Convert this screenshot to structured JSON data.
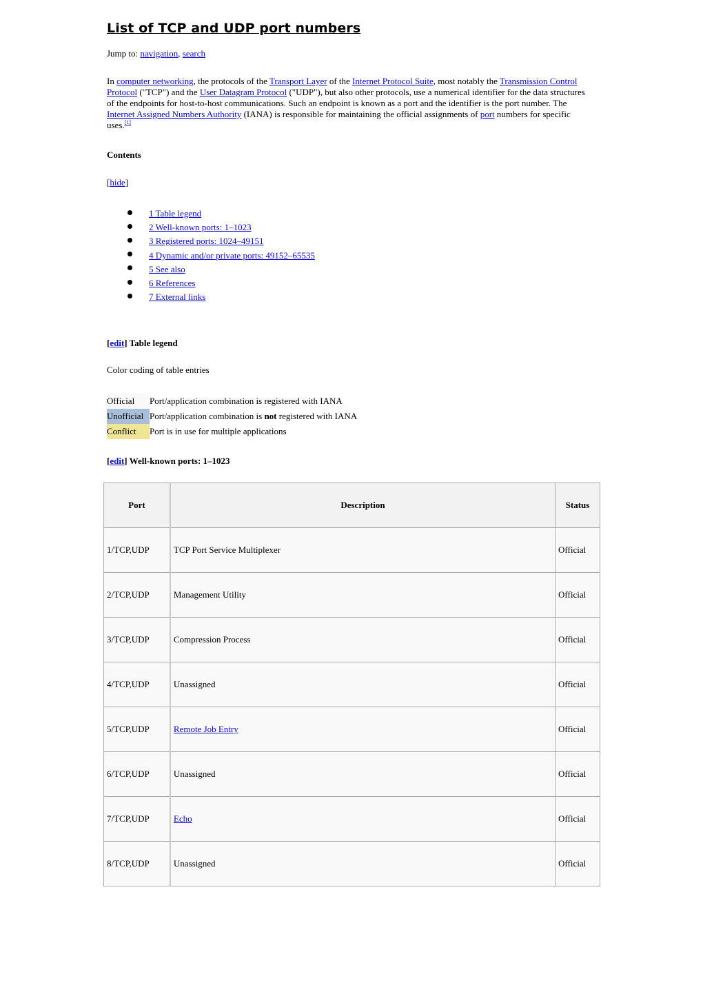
{
  "title": "List of TCP and UDP port numbers",
  "jump": {
    "prefix": "Jump to: ",
    "links": [
      "navigation",
      "search"
    ],
    "separator": ", "
  },
  "intro": {
    "t1": "In ",
    "l1": "computer networking",
    "t2": ", the protocols of the ",
    "l2": "Transport Layer",
    "t3": " of the ",
    "l3": "Internet Protocol Suite",
    "t4": ", most notably the ",
    "l4": "Transmission Control Protocol",
    "t5": " (\"TCP\") and the ",
    "l5": "User Datagram Protocol",
    "t6": " (\"UDP\"), but also other protocols, use a numerical identifier for the data structures of the endpoints for host-to-host communications. Such an endpoint is known as a port and the identifier is the port number. The ",
    "l6": "Internet Assigned Numbers Authority",
    "t7": " (IANA) is responsible for maintaining the official assignments of ",
    "l7": "port",
    "t8": " numbers for specific uses.",
    "ref": "[1]"
  },
  "contents": {
    "title": "Contents",
    "hide_open": "[",
    "hide_label": "hide",
    "hide_close": "]",
    "items": [
      "1 Table legend",
      "2 Well-known ports: 1–1023",
      "3 Registered ports: 1024–49151",
      "4 Dynamic and/or private ports: 49152–65535",
      "5 See also",
      "6 References",
      "7 External links"
    ]
  },
  "sections": {
    "edit_open": "[",
    "edit_label": "edit",
    "edit_close": "] ",
    "legend_title": "Table legend",
    "well_known_title": "Well-known ports: 1–1023"
  },
  "legend": {
    "description": "Color coding of table entries",
    "rows": [
      {
        "label": "Official",
        "color": "#f9f9f9",
        "text_before": "Port/application combination is registered with IANA",
        "bold": "",
        "text_after": ""
      },
      {
        "label": "Unofficial",
        "color": "#a9bfd9",
        "text_before": "Port/application combination is ",
        "bold": "not",
        "text_after": " registered with IANA"
      },
      {
        "label": "Conflict",
        "color": "#efe596",
        "text_before": "Port is in use for multiple applications",
        "bold": "",
        "text_after": ""
      }
    ]
  },
  "ports_table": {
    "headers": [
      "Port",
      "Description",
      "Status"
    ],
    "rows": [
      {
        "port": "1/TCP,UDP",
        "description": "TCP Port Service Multiplexer",
        "link": false,
        "status": "Official"
      },
      {
        "port": "2/TCP,UDP",
        "description": "Management Utility",
        "link": false,
        "status": "Official"
      },
      {
        "port": "3/TCP,UDP",
        "description": "Compression Process",
        "link": false,
        "status": "Official"
      },
      {
        "port": "4/TCP,UDP",
        "description": "Unassigned",
        "link": false,
        "status": "Official"
      },
      {
        "port": "5/TCP,UDP",
        "description": "Remote Job Entry",
        "link": true,
        "status": "Official"
      },
      {
        "port": "6/TCP,UDP",
        "description": "Unassigned",
        "link": false,
        "status": "Official"
      },
      {
        "port": "7/TCP,UDP",
        "description": "Echo",
        "link": true,
        "status": "Official"
      },
      {
        "port": "8/TCP,UDP",
        "description": "Unassigned",
        "link": false,
        "status": "Official"
      }
    ]
  },
  "colors": {
    "link": "#0b0bd6",
    "official": "#f9f9f9",
    "unofficial": "#a9bfd9",
    "conflict": "#efe596"
  }
}
